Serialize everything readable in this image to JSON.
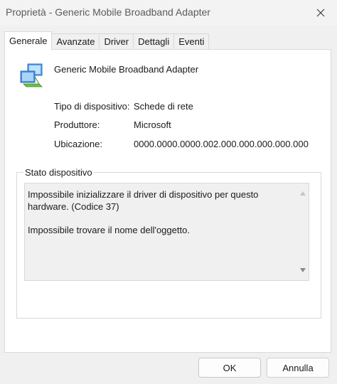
{
  "window": {
    "title": "Proprietà - Generic Mobile Broadband Adapter",
    "close_icon": "close-icon"
  },
  "tabs": [
    {
      "label": "Generale",
      "active": true
    },
    {
      "label": "Avanzate",
      "active": false
    },
    {
      "label": "Driver",
      "active": false
    },
    {
      "label": "Dettagli",
      "active": false
    },
    {
      "label": "Eventi",
      "active": false
    }
  ],
  "device": {
    "icon": "network-adapter-icon",
    "name": "Generic Mobile Broadband Adapter",
    "properties": [
      {
        "label": "Tipo di dispositivo:",
        "value": "Schede di rete"
      },
      {
        "label": "Produttore:",
        "value": "Microsoft"
      },
      {
        "label": "Ubicazione:",
        "value": "0000.0000.0000.002.000.000.000.000.000"
      }
    ]
  },
  "status": {
    "group_label": "Stato dispositivo",
    "line1": "Impossibile inizializzare il driver di dispositivo per questo hardware. (Codice 37)",
    "line2": "Impossibile trovare il nome dell'oggetto."
  },
  "buttons": {
    "ok": "OK",
    "cancel": "Annulla"
  }
}
